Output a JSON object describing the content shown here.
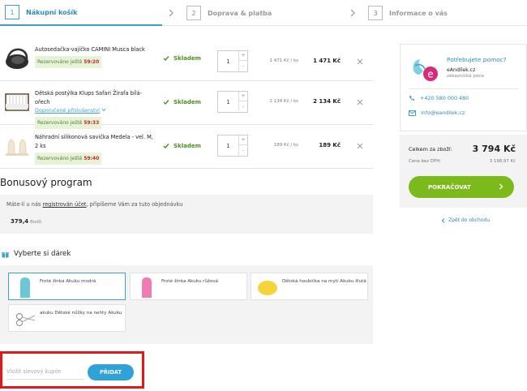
{
  "steps": [
    {
      "num": "1",
      "label": "Nákupní košík"
    },
    {
      "num": "2",
      "label": "Doprava & platba"
    },
    {
      "num": "3",
      "label": "Informace o vás"
    }
  ],
  "items": [
    {
      "name": "Autosedačka-vajíčko CAMINI Musca black",
      "link": "",
      "reserve_label": "Rezervováno ještě",
      "reserve_time": "59:20",
      "stock": "Skladem",
      "qty": "1",
      "unit_price": "1 471 Kč / ks",
      "total": "1 471 Kč"
    },
    {
      "name": "Dětská postýlka Klups Safari Žirafa bílá-ořech",
      "link": "Doporučené příslušenství",
      "reserve_label": "Rezervováno ještě",
      "reserve_time": "59:33",
      "stock": "Skladem",
      "qty": "1",
      "unit_price": "2 134 Kč / ks",
      "total": "2 134 Kč"
    },
    {
      "name": "Náhradní silikonová savička Medela - vel. M, 2 ks",
      "link": "",
      "reserve_label": "Rezervováno ještě",
      "reserve_time": "59:40",
      "stock": "Skladem",
      "qty": "1",
      "unit_price": "189 Kč / ks",
      "total": "189 Kč"
    }
  ],
  "bonus": {
    "title": "Bonusový program",
    "text_before": "Máte-li u nás ",
    "text_link": "registrován účet",
    "text_after": ", připíšeme Vám za tuto objednávku",
    "points": "379,4",
    "points_unit": "Bodů"
  },
  "gift": {
    "title": "Vyberte si dárek",
    "items": [
      {
        "name": "Froté žínka Akuku modrá"
      },
      {
        "name": "Froté žínka Akuku růžová"
      },
      {
        "name": "Dětská houbička na mytí Akuku žlutá"
      },
      {
        "name": "akuku Dětské nůžky na nehty Akuku"
      }
    ]
  },
  "coupon": {
    "placeholder": "Vložit slevový kupón",
    "button": "PŘIDAT"
  },
  "help": {
    "title": "Potřebujete pomoc?",
    "name": "eAndílek.cz",
    "subtitle": "zákaznická péče",
    "phone": "+420 580 000 480",
    "email": "info@eandilek.cz"
  },
  "summary": {
    "total_label": "Celkem za zboží:",
    "total": "3 794 Kč",
    "net_label": "Cena bez DPH:",
    "net": "3 198,97 Kč",
    "continue": "POKRAČOVAT",
    "back": "Zpět do obchodu"
  },
  "colors": {
    "accent": "#3fa1c9",
    "green": "#7cb91a",
    "highlight": "#e01919"
  }
}
